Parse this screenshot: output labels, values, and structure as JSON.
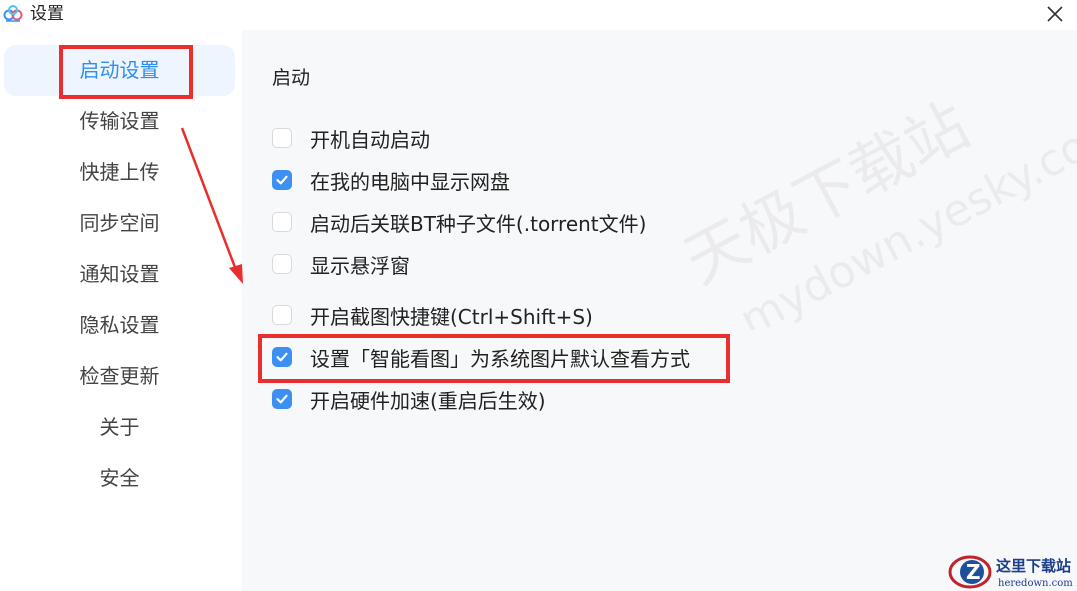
{
  "window": {
    "title": "设置",
    "close_icon": "close-icon"
  },
  "sidebar": {
    "items": [
      {
        "label": "启动设置",
        "active": true
      },
      {
        "label": "传输设置",
        "active": false
      },
      {
        "label": "快捷上传",
        "active": false
      },
      {
        "label": "同步空间",
        "active": false
      },
      {
        "label": "通知设置",
        "active": false
      },
      {
        "label": "隐私设置",
        "active": false
      },
      {
        "label": "检查更新",
        "active": false
      },
      {
        "label": "关于",
        "active": false
      },
      {
        "label": "安全",
        "active": false
      }
    ]
  },
  "main": {
    "section_title": "启动",
    "options": [
      {
        "label": "开机自动启动",
        "checked": false
      },
      {
        "label": "在我的电脑中显示网盘",
        "checked": true
      },
      {
        "label": "启动后关联BT种子文件(.torrent文件)",
        "checked": false
      },
      {
        "label": "显示悬浮窗",
        "checked": false
      },
      {
        "label": "开启截图快捷键(Ctrl+Shift+S)",
        "checked": false
      },
      {
        "label": "设置「智能看图」为系统图片默认查看方式",
        "checked": true
      },
      {
        "label": "开启硬件加速(重启后生效)",
        "checked": true
      }
    ]
  },
  "watermark": {
    "text_cn": "天极下载站",
    "text_url": "mydown.yesky.com"
  },
  "corner_logo": {
    "title": "这里下载站",
    "url": "heredown.com"
  },
  "colors": {
    "accent": "#3d8ff1",
    "annotation": "#ea2e2e",
    "active_bg": "#eef5fe"
  }
}
